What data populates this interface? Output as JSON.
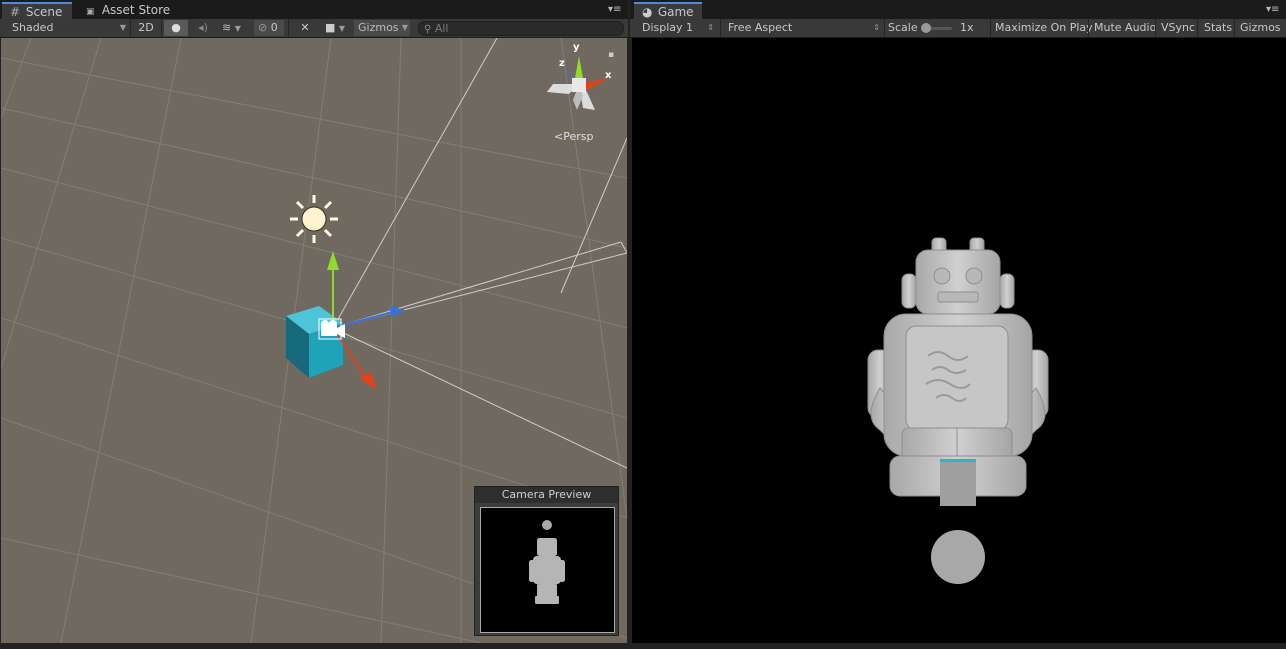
{
  "scene_panel": {
    "tabs": [
      {
        "label": "Scene",
        "icon": "grid-icon",
        "active": true
      },
      {
        "label": "Asset Store",
        "icon": "shopping-bag-icon",
        "active": false
      }
    ],
    "toolbar": {
      "shading_mode": "Shaded",
      "mode_2d": "2D",
      "hidden_count": "0",
      "gizmos_label": "Gizmos",
      "search_placeholder": "All"
    },
    "orientation_label": "Persp",
    "axis_labels": {
      "x": "x",
      "y": "y",
      "z": "z"
    },
    "camera_preview_title": "Camera Preview"
  },
  "game_panel": {
    "tab": {
      "label": "Game",
      "icon": "pacman-icon"
    },
    "toolbar": {
      "display": "Display 1",
      "aspect": "Free Aspect",
      "scale_label": "Scale",
      "scale_value": "1x",
      "maximize_on_play": "Maximize On Play",
      "mute_audio": "Mute Audio",
      "vsync": "VSync",
      "stats": "Stats",
      "gizmos": "Gizmos"
    }
  },
  "colors": {
    "scene_ground": "#706960",
    "grid_line": "#8a847b",
    "cube": "#1fa3b9",
    "x_axis": "#e0421e",
    "y_axis": "#8fdc2a",
    "z_axis": "#3a6fe0",
    "game_bg": "#000000",
    "robot": "#bdbdbd"
  }
}
